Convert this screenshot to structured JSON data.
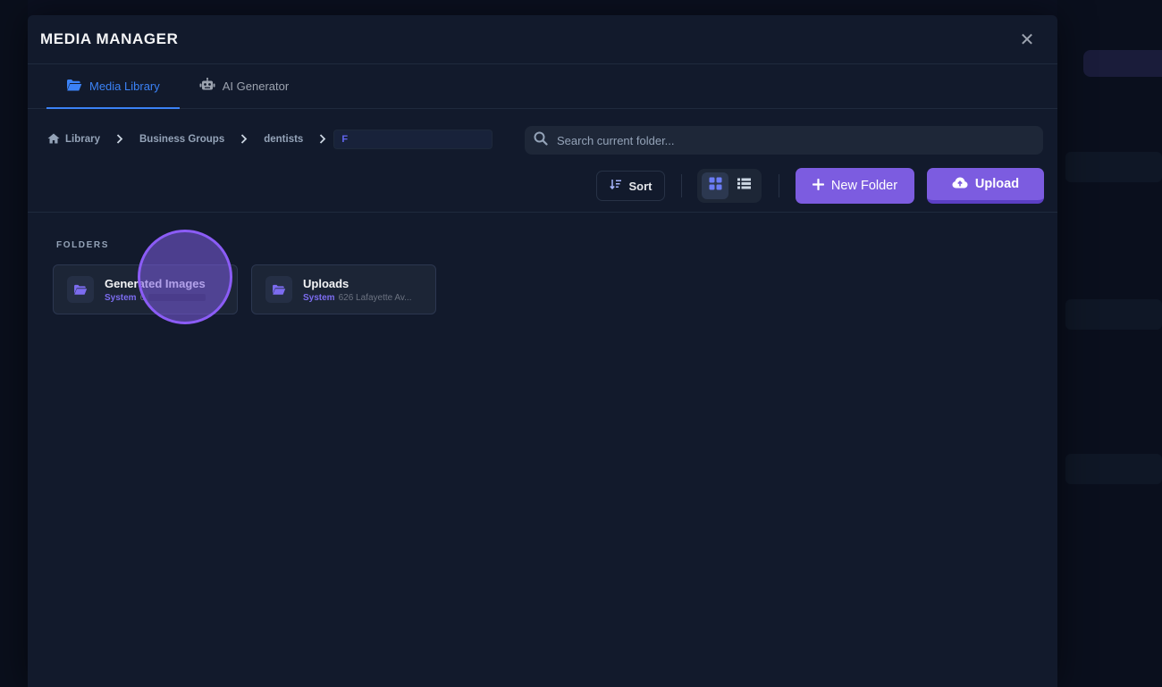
{
  "modal": {
    "title": "MEDIA MANAGER",
    "close_icon": "close-icon"
  },
  "tabs": [
    {
      "label": "Media Library",
      "icon": "folder-open-icon",
      "active": true
    },
    {
      "label": "AI Generator",
      "icon": "robot-icon",
      "active": false
    }
  ],
  "breadcrumb": {
    "items": [
      {
        "label": "Library",
        "icon": "home-icon"
      },
      {
        "label": "Business Groups"
      },
      {
        "label": "dentists"
      }
    ],
    "current_value": "F"
  },
  "search": {
    "placeholder": "Search current folder..."
  },
  "toolbar": {
    "sort_label": "Sort",
    "new_folder_label": "New Folder",
    "upload_label": "Upload",
    "view_mode": "grid"
  },
  "folders_section": {
    "label": "FOLDERS",
    "items": [
      {
        "name": "Generated Images",
        "badge": "System",
        "meta": "6"
      },
      {
        "name": "Uploads",
        "badge": "System",
        "meta": "626 Lafayette Av..."
      }
    ]
  },
  "colors": {
    "accent": "#7c5ce0",
    "tab_active": "#3b82f6",
    "background": "#121a2c"
  }
}
